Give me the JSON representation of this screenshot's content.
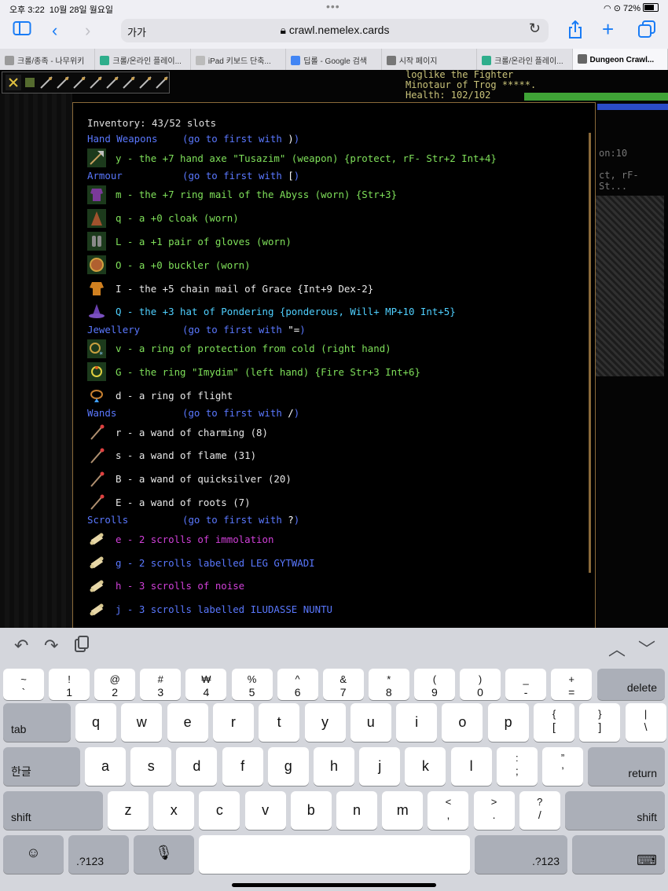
{
  "status": {
    "time": "오후 3:22",
    "date": "10월 28일 월요일",
    "battery": "72%"
  },
  "browser": {
    "text_size": "가가",
    "url": "crawl.nemelex.cards",
    "tabs": [
      {
        "label": "크롤/종족 - 나무위키",
        "fav_color": "#9a9a9a"
      },
      {
        "label": "크롤/온라인 플레이...",
        "fav_color": "#2fae8c"
      },
      {
        "label": "iPad 키보드 단축...",
        "fav_color": "#bbbbbb"
      },
      {
        "label": "딥롤 - Google 검색",
        "fav_color": "#4285f4"
      },
      {
        "label": "시작 페이지",
        "fav_color": "#777777"
      },
      {
        "label": "크롤/온라인 플레이...",
        "fav_color": "#2fae8c"
      },
      {
        "label": "Dungeon Crawl...",
        "fav_color": "#666666"
      }
    ]
  },
  "game": {
    "char_line1": "loglike the Fighter",
    "char_line2": "Minotaur of Trog *****.",
    "char_line3": "Health: 102/102",
    "side_frag1": "on:10",
    "side_frag2": "ct, rF- St..."
  },
  "inventory": {
    "title": "Inventory: 43/52 slots",
    "goto_text": "(go to first with",
    "categories": [
      {
        "name": "Hand Weapons",
        "sym": ")",
        "items": [
          {
            "text": "y - the +7 hand axe \"Tusazim\" (weapon) {protect, rF- Str+2 Int+4}",
            "color": "g",
            "icon": "axe"
          }
        ]
      },
      {
        "name": "Armour",
        "sym": "[",
        "items": [
          {
            "text": "m - the +7 ring mail of the Abyss (worn) {Str+3}",
            "color": "g",
            "icon": "mail"
          },
          {
            "text": "q - a +0 cloak (worn)",
            "color": "g",
            "icon": "cloak"
          },
          {
            "text": "L - a +1 pair of gloves (worn)",
            "color": "g",
            "icon": "gloves"
          },
          {
            "text": "O - a +0 buckler (worn)",
            "color": "g",
            "icon": "buckler"
          },
          {
            "text": "I - the +5 chain mail of Grace {Int+9 Dex-2}",
            "color": "w",
            "icon": "chain"
          },
          {
            "text": "Q - the +3 hat of Pondering {ponderous, Will+ MP+10 Int+5}",
            "color": "c",
            "icon": "hat"
          }
        ]
      },
      {
        "name": "Jewellery",
        "sym": "\"=",
        "items": [
          {
            "text": "v - a ring of protection from cold (right hand)",
            "color": "g",
            "icon": "ring-cold"
          },
          {
            "text": "G - the ring \"Imydim\" (left hand) {Fire Str+3 Int+6}",
            "color": "g",
            "icon": "ring-fire"
          },
          {
            "text": "d - a ring of flight",
            "color": "w",
            "icon": "ring-flight"
          }
        ]
      },
      {
        "name": "Wands",
        "sym": "/",
        "items": [
          {
            "text": "r - a wand of charming (8)",
            "color": "w",
            "icon": "wand"
          },
          {
            "text": "s - a wand of flame (31)",
            "color": "w",
            "icon": "wand"
          },
          {
            "text": "B - a wand of quicksilver (20)",
            "color": "w",
            "icon": "wand"
          },
          {
            "text": "E - a wand of roots (7)",
            "color": "w",
            "icon": "wand"
          }
        ]
      },
      {
        "name": "Scrolls",
        "sym": "?",
        "items": [
          {
            "text": "e - 2 scrolls of immolation",
            "color": "m",
            "icon": "scroll"
          },
          {
            "text": "g - 2 scrolls labelled LEG GYTWADI",
            "color": "b",
            "icon": "scroll"
          },
          {
            "text": "h - 3 scrolls of noise",
            "color": "m",
            "icon": "scroll"
          },
          {
            "text": "j - 3 scrolls labelled ILUDASSE NUNTU",
            "color": "b",
            "icon": "scroll"
          }
        ]
      }
    ]
  },
  "keyboard": {
    "row1": [
      [
        "~",
        "`"
      ],
      [
        "!",
        "1"
      ],
      [
        "@",
        "2"
      ],
      [
        "#",
        "3"
      ],
      [
        "₩",
        "4"
      ],
      [
        "%",
        "5"
      ],
      [
        "^",
        "6"
      ],
      [
        "&",
        "7"
      ],
      [
        "*",
        "8"
      ],
      [
        "(",
        "9"
      ],
      [
        ")",
        "0"
      ],
      [
        "_",
        "-"
      ],
      [
        "+",
        "="
      ]
    ],
    "row2": [
      "q",
      "w",
      "e",
      "r",
      "t",
      "y",
      "u",
      "i",
      "o",
      "p",
      [
        "{",
        "["
      ],
      [
        "}",
        "]"
      ],
      [
        "|",
        "\\"
      ]
    ],
    "row3": [
      "a",
      "s",
      "d",
      "f",
      "g",
      "h",
      "j",
      "k",
      "l",
      [
        ":",
        ";"
      ],
      [
        "”",
        "’"
      ]
    ],
    "row4": [
      "z",
      "x",
      "c",
      "v",
      "b",
      "n",
      "m",
      [
        "<",
        ","
      ],
      [
        ">",
        "."
      ],
      [
        "?",
        "/"
      ]
    ],
    "delete": "delete",
    "tab": "tab",
    "lang": "한글",
    "return": "return",
    "shift": "shift",
    "num": ".?123"
  }
}
